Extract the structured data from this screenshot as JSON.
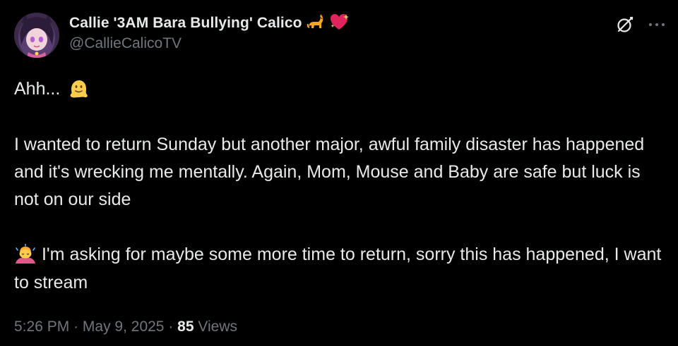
{
  "author": {
    "display_name": "Callie '3AM Bara Bullying' Calico",
    "handle": "@CallieCalicoTV",
    "name_emojis": [
      "cat-emoji",
      "sparkling-heart-emoji"
    ]
  },
  "actions": {
    "grok_icon": "grok-icon",
    "more_icon": "more-icon"
  },
  "tweet": {
    "line1_text": "Ahh...",
    "line1_emoji": "melting-face-emoji",
    "para2": "I wanted to return Sunday but another major, awful family disaster has happened and it's wrecking me mentally. Again, Mom, Mouse and Baby are safe but luck is not on our side",
    "para3_emoji": "person-bowing-emoji",
    "para3_text": "I'm asking for maybe some more time to return, sorry this has happened, I want to stream"
  },
  "meta": {
    "time": "5:26 PM",
    "separator": "·",
    "date": "May 9, 2025",
    "views_count": "85",
    "views_label": "Views"
  },
  "colors": {
    "background": "#000000",
    "text": "#e7e9ea",
    "secondary": "#71767b"
  }
}
